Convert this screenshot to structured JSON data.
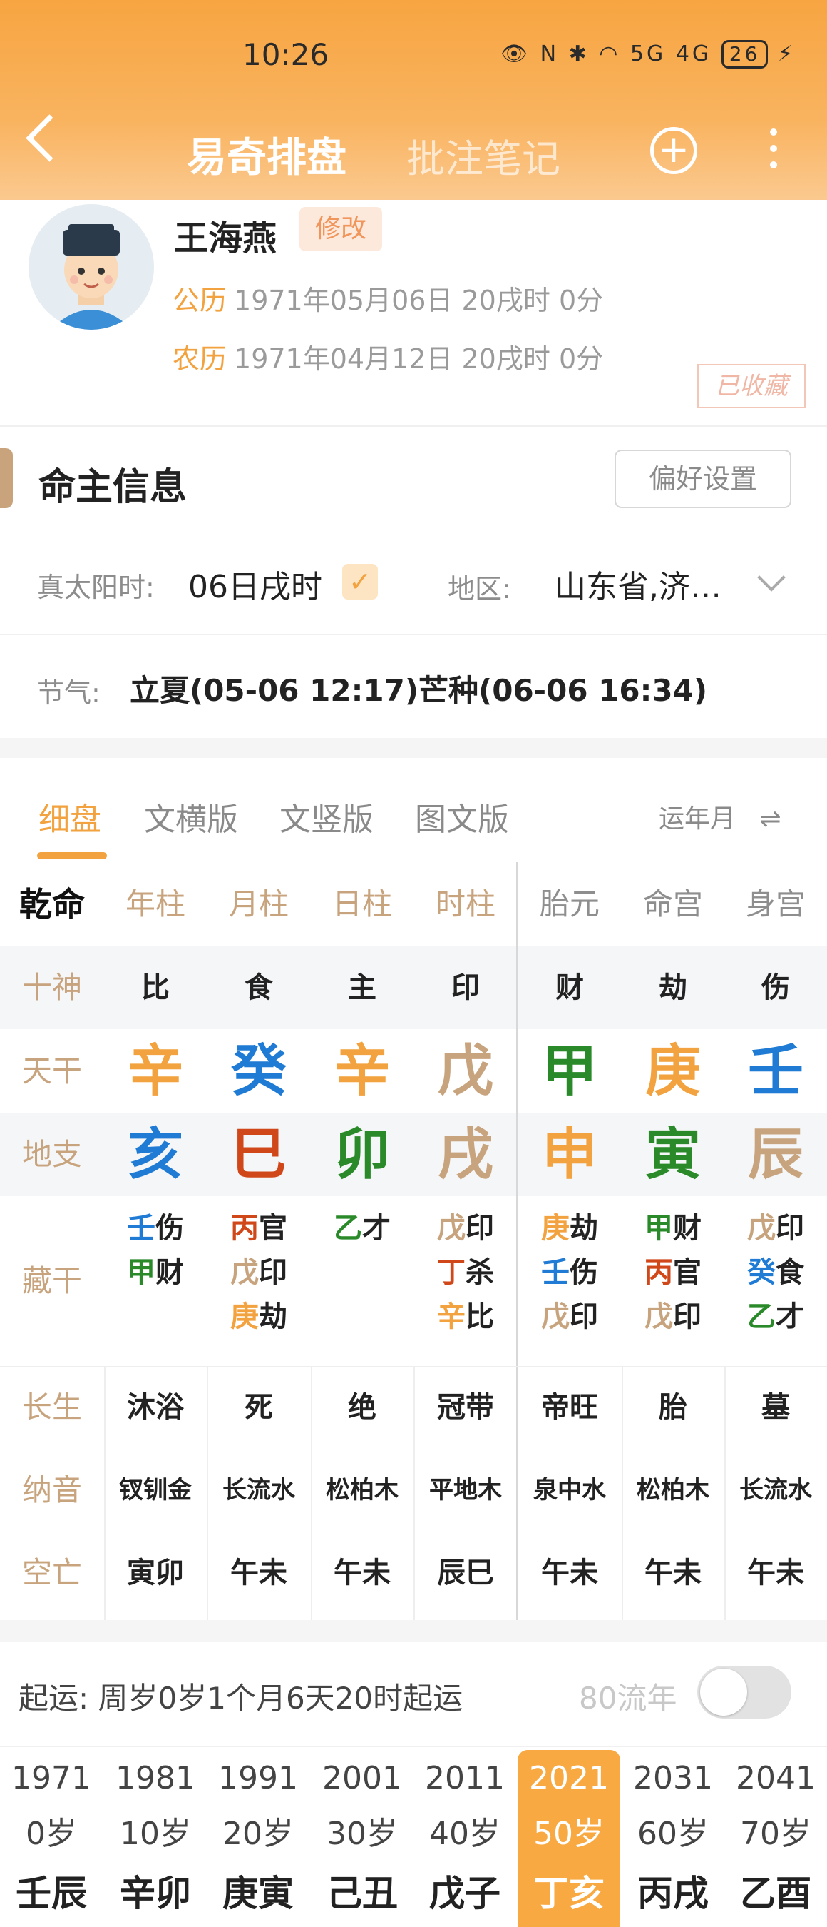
{
  "status_bar": {
    "time": "10:26",
    "icons": "👁 N ✱ ◠ 5G 4G",
    "battery": "26"
  },
  "nav": {
    "title_main": "易奇排盘",
    "title_note": "批注笔记"
  },
  "profile": {
    "name": "王海燕",
    "edit_label": "修改",
    "solar_label": "公历",
    "solar_value": "1971年05月06日 20戌时 0分",
    "lunar_label": "农历",
    "lunar_value": "1971年04月12日 20戌时 0分",
    "stamp": "已收藏"
  },
  "info": {
    "title": "命主信息",
    "pref_button": "偏好设置",
    "true_solar_label": "真太阳时:",
    "true_solar_value": "06日戌时",
    "region_label": "地区:",
    "region_value": "山东省,济…",
    "jieqi_label": "节气:",
    "jieqi_value": "立夏(05-06 12:17)芒种(06-06 16:34)"
  },
  "tabs": [
    "细盘",
    "文横版",
    "文竖版",
    "图文版"
  ],
  "tab_right": "运年月",
  "colors": {
    "orange": "#f2a23e",
    "blue": "#1f7bd4",
    "green": "#2a8a2a",
    "red": "#d0481a",
    "tan": "#c8a47e"
  },
  "table": {
    "corner": "乾命",
    "headers": [
      "年柱",
      "月柱",
      "日柱",
      "时柱",
      "胎元",
      "命宫",
      "身宫"
    ],
    "row_labels": [
      "十神",
      "天干",
      "地支",
      "藏干",
      "长生",
      "纳音",
      "空亡"
    ],
    "shishen": [
      "比",
      "食",
      "主",
      "印",
      "财",
      "劫",
      "伤"
    ],
    "tiangan": [
      {
        "char": "辛",
        "color": "#f2a23e"
      },
      {
        "char": "癸",
        "color": "#1f7bd4"
      },
      {
        "char": "辛",
        "color": "#f2a23e"
      },
      {
        "char": "戊",
        "color": "#c8a47e"
      },
      {
        "char": "甲",
        "color": "#2a8a2a"
      },
      {
        "char": "庚",
        "color": "#f2a23e"
      },
      {
        "char": "壬",
        "color": "#1f7bd4"
      }
    ],
    "dizhi": [
      {
        "char": "亥",
        "color": "#1f7bd4"
      },
      {
        "char": "巳",
        "color": "#d0481a"
      },
      {
        "char": "卯",
        "color": "#2a8a2a"
      },
      {
        "char": "戌",
        "color": "#c8a47e"
      },
      {
        "char": "申",
        "color": "#f2a23e"
      },
      {
        "char": "寅",
        "color": "#2a8a2a"
      },
      {
        "char": "辰",
        "color": "#c8a47e"
      }
    ],
    "canggan": [
      [
        {
          "g": "壬",
          "c": "#1f7bd4",
          "s": "伤"
        },
        {
          "g": "甲",
          "c": "#2a8a2a",
          "s": "财"
        }
      ],
      [
        {
          "g": "丙",
          "c": "#d0481a",
          "s": "官"
        },
        {
          "g": "戊",
          "c": "#c8a47e",
          "s": "印"
        },
        {
          "g": "庚",
          "c": "#f2a23e",
          "s": "劫"
        }
      ],
      [
        {
          "g": "乙",
          "c": "#2a8a2a",
          "s": "才"
        }
      ],
      [
        {
          "g": "戊",
          "c": "#c8a47e",
          "s": "印"
        },
        {
          "g": "丁",
          "c": "#d0481a",
          "s": "杀"
        },
        {
          "g": "辛",
          "c": "#f2a23e",
          "s": "比"
        }
      ],
      [
        {
          "g": "庚",
          "c": "#f2a23e",
          "s": "劫"
        },
        {
          "g": "壬",
          "c": "#1f7bd4",
          "s": "伤"
        },
        {
          "g": "戊",
          "c": "#c8a47e",
          "s": "印"
        }
      ],
      [
        {
          "g": "甲",
          "c": "#2a8a2a",
          "s": "财"
        },
        {
          "g": "丙",
          "c": "#d0481a",
          "s": "官"
        },
        {
          "g": "戊",
          "c": "#c8a47e",
          "s": "印"
        }
      ],
      [
        {
          "g": "戊",
          "c": "#c8a47e",
          "s": "印"
        },
        {
          "g": "癸",
          "c": "#1f7bd4",
          "s": "食"
        },
        {
          "g": "乙",
          "c": "#2a8a2a",
          "s": "才"
        }
      ]
    ],
    "changsheng": [
      "沐浴",
      "死",
      "绝",
      "冠带",
      "帝旺",
      "胎",
      "墓"
    ],
    "nayin": [
      "钗钏金",
      "长流水",
      "松柏木",
      "平地木",
      "泉中水",
      "松柏木",
      "长流水"
    ],
    "kongwang": [
      "寅卯",
      "午未",
      "午未",
      "辰巳",
      "午未",
      "午未",
      "午未"
    ]
  },
  "qiyun": {
    "text": "起运:  周岁0岁1个月6天20时起运",
    "liunian_label": "80流年"
  },
  "dayun": [
    {
      "year": "1971",
      "age": "0岁",
      "gz": "壬辰"
    },
    {
      "year": "1981",
      "age": "10岁",
      "gz": "辛卯"
    },
    {
      "year": "1991",
      "age": "20岁",
      "gz": "庚寅"
    },
    {
      "year": "2001",
      "age": "30岁",
      "gz": "己丑"
    },
    {
      "year": "2011",
      "age": "40岁",
      "gz": "戊子"
    },
    {
      "year": "2021",
      "age": "50岁",
      "gz": "丁亥"
    },
    {
      "year": "2031",
      "age": "60岁",
      "gz": "丙戌"
    },
    {
      "year": "2041",
      "age": "70岁",
      "gz": "乙酉"
    }
  ],
  "dayun_active_index": 5
}
